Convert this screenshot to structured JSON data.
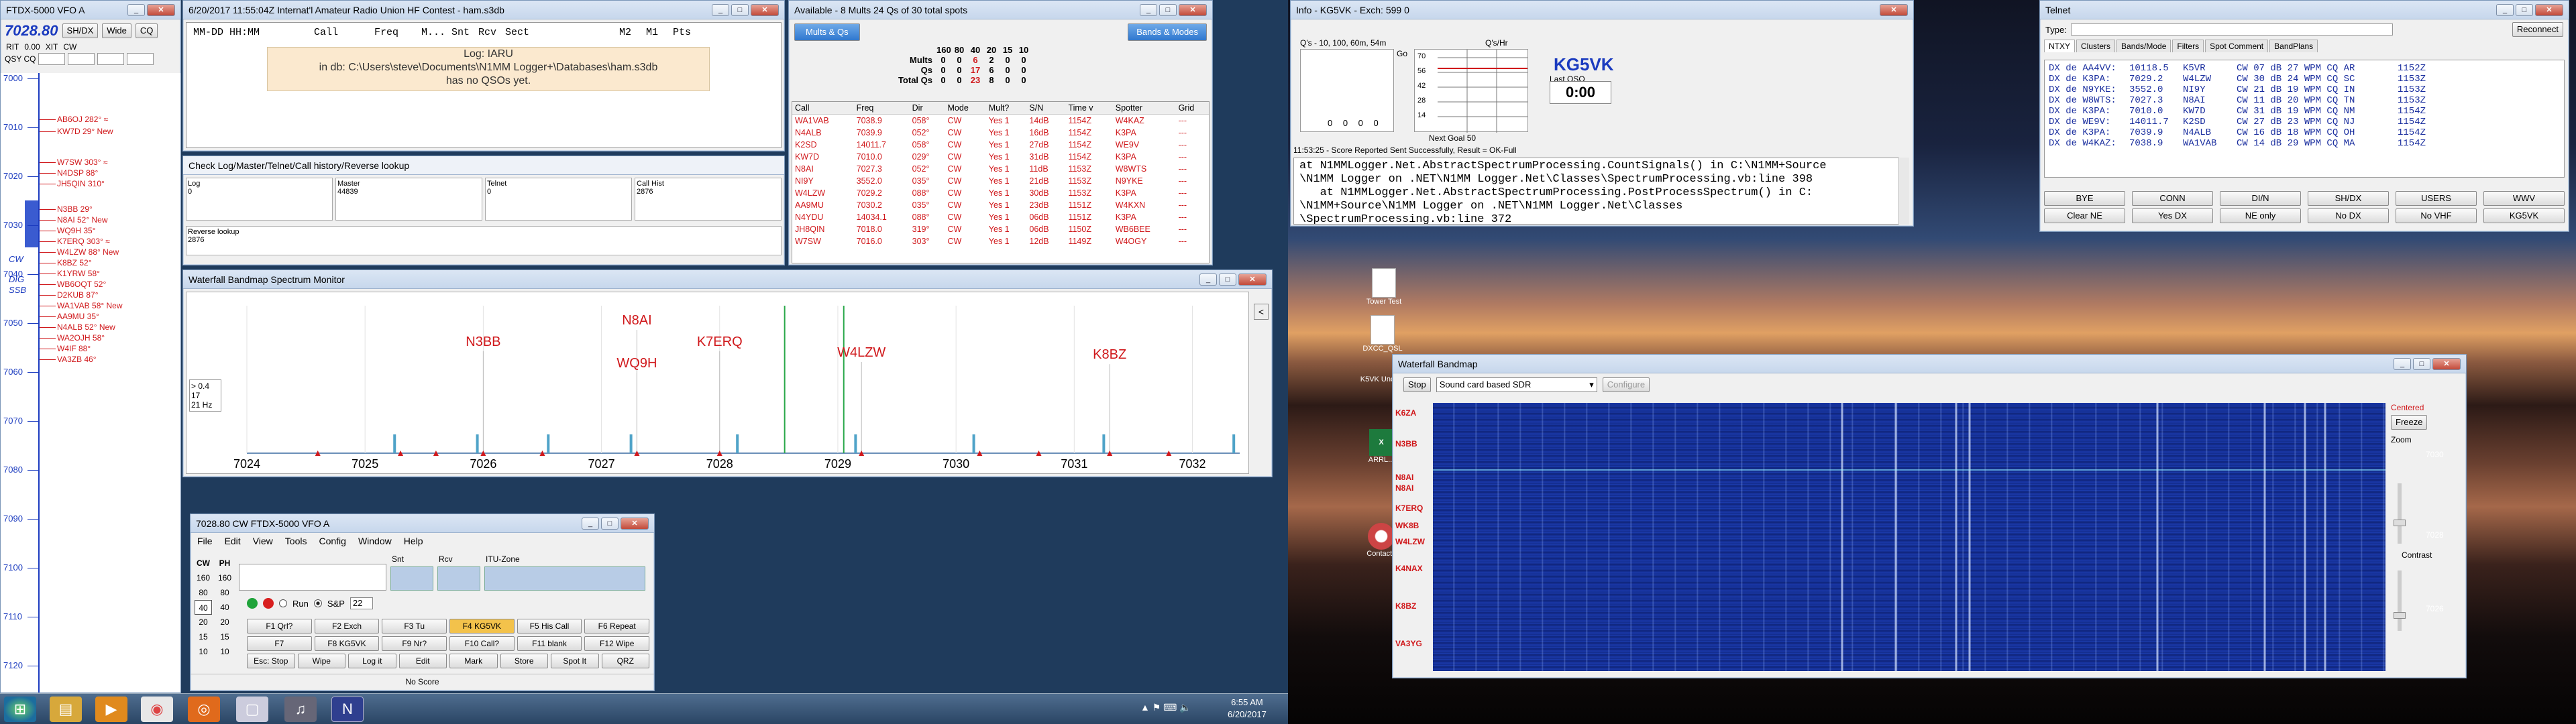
{
  "vfo": {
    "title": "FTDX-5000 VFO A",
    "freq": "7028.80",
    "buttons": [
      "SH/DX",
      "Wide",
      "CQ"
    ],
    "rit": "RIT",
    "rit_val": "0.00",
    "xit": "XIT",
    "cw": "CW",
    "qsy_cq": "QSY CQ",
    "scale": [
      "7000",
      "7010",
      "7020",
      "7030",
      "7040",
      "7050",
      "7060",
      "7070",
      "7080",
      "7090",
      "7100",
      "7110",
      "7120"
    ],
    "mode_labels": [
      "CW",
      "SSB",
      "DIG"
    ],
    "spots": [
      {
        "text": "AB6OJ 282° ≈",
        "color": "#d0181b"
      },
      {
        "text": "KW7D 29° New",
        "color": "#d0181b"
      },
      {
        "text": "W7SW 303° ≈",
        "color": "#d0181b"
      },
      {
        "text": "N4DSP 88°",
        "color": "#d0181b"
      },
      {
        "text": "JH5QIN 310°",
        "color": "#d0181b"
      },
      {
        "text": "N3BB 29°",
        "color": "#d0181b"
      },
      {
        "text": "N8AI 52° New",
        "color": "#d0181b"
      },
      {
        "text": "WQ9H 35°",
        "color": "#d0181b"
      },
      {
        "text": "K7ERQ 303° ≈",
        "color": "#d0181b"
      },
      {
        "text": "W4LZW 88° New",
        "color": "#d0181b"
      },
      {
        "text": "K8BZ 52°",
        "color": "#d0181b"
      },
      {
        "text": "K1YRW 58°",
        "color": "#d0181b"
      },
      {
        "text": "WB6OQT 52°",
        "color": "#d0181b"
      },
      {
        "text": "D2KUB 87°",
        "color": "#d0181b"
      },
      {
        "text": "WA1VAB 58° New",
        "color": "#d0181b"
      },
      {
        "text": "AA9MU 35°",
        "color": "#d0181b"
      },
      {
        "text": "N4ALB 52° New",
        "color": "#d0181b"
      },
      {
        "text": "WA2OJH 58°",
        "color": "#d0181b"
      },
      {
        "text": "W4IF 88°",
        "color": "#d0181b"
      },
      {
        "text": "VA3ZB 46°",
        "color": "#d0181b"
      }
    ]
  },
  "log": {
    "title": "6/20/2017 11:55:04Z  Internat'l Amateur Radio Union HF Contest - ham.s3db",
    "headers": [
      "MM-DD HH:MM",
      "Call",
      "Freq",
      "M...",
      "Snt",
      "Rcv",
      "Sect",
      "M2",
      "M1",
      "Pts"
    ],
    "msg1": "Log: IARU",
    "msg2": "in db: C:\\Users\\steve\\Documents\\N1MM Logger+\\Databases\\ham.s3db",
    "msg3": "has no QSOs yet."
  },
  "checklog": {
    "title": "Check Log/Master/Telnet/Call history/Reverse lookup",
    "cols": [
      {
        "label": "Log",
        "val": "0"
      },
      {
        "label": "Master",
        "val": "44839"
      },
      {
        "label": "Telnet",
        "val": "0"
      },
      {
        "label": "Call Hist",
        "val": "2876"
      }
    ],
    "rev_label": "Reverse lookup",
    "rev_val": "2876"
  },
  "available": {
    "title": "Available - 8 Mults 24 Qs of 30 total spots",
    "btn_left": "Mults & Qs",
    "btn_right": "Bands & Modes",
    "bands": [
      "160",
      "80",
      "40",
      "20",
      "15",
      "10"
    ],
    "rows": [
      {
        "label": "Mults",
        "vals": [
          "0",
          "0",
          "6",
          "2",
          "0",
          "0"
        ]
      },
      {
        "label": "Qs",
        "vals": [
          "0",
          "0",
          "17",
          "6",
          "0",
          "0"
        ]
      },
      {
        "label": "Total Qs",
        "vals": [
          "0",
          "0",
          "23",
          "8",
          "0",
          "0"
        ]
      }
    ],
    "table_headers": [
      "Call",
      "Freq",
      "Dir",
      "Mode",
      "Mult?",
      "S/N",
      "Time v",
      "Spotter",
      "Grid"
    ],
    "table_rows": [
      [
        "WA1VAB",
        "7038.9",
        "058°",
        "CW",
        "Yes 1",
        "14dB",
        "1154Z",
        "W4KAZ",
        "---"
      ],
      [
        "N4ALB",
        "7039.9",
        "052°",
        "CW",
        "Yes 1",
        "16dB",
        "1154Z",
        "K3PA",
        "---"
      ],
      [
        "K2SD",
        "14011.7",
        "058°",
        "CW",
        "Yes 1",
        "27dB",
        "1154Z",
        "WE9V",
        "---"
      ],
      [
        "KW7D",
        "7010.0",
        "029°",
        "CW",
        "Yes 1",
        "31dB",
        "1154Z",
        "K3PA",
        "---"
      ],
      [
        "N8AI",
        "7027.3",
        "052°",
        "CW",
        "Yes 1",
        "11dB",
        "1153Z",
        "W8WTS",
        "---"
      ],
      [
        "NI9Y",
        "3552.0",
        "035°",
        "CW",
        "Yes 1",
        "21dB",
        "1153Z",
        "N9YKE",
        "---"
      ],
      [
        "W4LZW",
        "7029.2",
        "088°",
        "CW",
        "Yes 1",
        "30dB",
        "1153Z",
        "K3PA",
        "---"
      ],
      [
        "AA9MU",
        "7030.2",
        "035°",
        "CW",
        "Yes 1",
        "23dB",
        "1151Z",
        "W4KXN",
        "---"
      ],
      [
        "N4YDU",
        "14034.1",
        "088°",
        "CW",
        "Yes 1",
        "06dB",
        "1151Z",
        "K3PA",
        "---"
      ],
      [
        "JH8QIN",
        "7018.0",
        "319°",
        "CW",
        "Yes 1",
        "06dB",
        "1150Z",
        "WB6BEE",
        "---"
      ],
      [
        "W7SW",
        "7016.0",
        "303°",
        "CW",
        "Yes 1",
        "12dB",
        "1149Z",
        "W4OGY",
        "---"
      ]
    ]
  },
  "bandmap": {
    "title": "Waterfall Bandmap Spectrum Monitor",
    "side": [
      "> 0.4",
      "17",
      "21 Hz"
    ],
    "axis": [
      "7024",
      "7025",
      "7026",
      "7027",
      "7028",
      "7029",
      "7030",
      "7031",
      "7032"
    ],
    "spot_labels": [
      {
        "call": "N3BB",
        "freq": 7026.0,
        "row": 0
      },
      {
        "call": "N8AI",
        "freq": 7027.3,
        "row": -1
      },
      {
        "call": "WQ9H",
        "freq": 7027.3,
        "row": 1
      },
      {
        "call": "K7ERQ",
        "freq": 7028.0,
        "row": 0
      },
      {
        "call": "W4LZW",
        "freq": 7029.2,
        "row": 0.5
      },
      {
        "call": "K8BZ",
        "freq": 7031.3,
        "row": 0.6
      }
    ]
  },
  "entry": {
    "title": "7028.80 CW FTDX-5000 VFO A",
    "menu": [
      "File",
      "Edit",
      "View",
      "Tools",
      "Config",
      "Window",
      "Help"
    ],
    "bands_cw": [
      "CW",
      "160",
      "80",
      "40",
      "20",
      "15",
      "10"
    ],
    "bands_ph": [
      "PH",
      "160",
      "80",
      "40",
      "20",
      "15",
      "10"
    ],
    "field_labels": [
      "Snt",
      "Rcv",
      "ITU-Zone"
    ],
    "run": "Run",
    "sp": "S&P",
    "sp_num": "22",
    "fkeys": [
      [
        "F1 Qrl?",
        "F2 Exch",
        "F3 Tu",
        "F4 KG5VK",
        "F5 His Call",
        "F6 Repeat"
      ],
      [
        "F7",
        "F8 KG5VK",
        "F9 Nr?",
        "F10 Call?",
        "F11 blank",
        "F12 Wipe"
      ],
      [
        "Esc: Stop",
        "Wipe",
        "Log it",
        "Edit",
        "Mark",
        "Store",
        "Spot It",
        "QRZ"
      ]
    ],
    "status": "No Score"
  },
  "info": {
    "title": "Info - KG5VK - Exch: 599 0",
    "qs_label": "Q's - 10, 100, 60m, 54m",
    "go": "Go",
    "zeros": "0 0 0 0",
    "rate_title": "Q's/Hr",
    "rate_ticks": [
      "70",
      "56",
      "42",
      "28",
      "14"
    ],
    "next_goal": "Next Goal 50",
    "call": "KG5VK",
    "last_qso": "Last QSO",
    "time": "0:00",
    "score_line": "11:53:25 - Score Reported Sent Successfully, Result = OK-Full",
    "stack": [
      "at N1MMLogger.Net.AbstractSpectrumProcessing.CountSignals() in C:\\N1MM+Source",
      "\\N1MM Logger on .NET\\N1MM Logger.Net\\Classes\\SpectrumProcessing.vb:line 398",
      "   at N1MMLogger.Net.AbstractSpectrumProcessing.PostProcessSpectrum() in C:",
      "\\N1MM+Source\\N1MM Logger on .NET\\N1MM Logger.Net\\Classes",
      "\\SpectrumProcessing.vb:line 372"
    ]
  },
  "telnet": {
    "title": "Telnet",
    "type_label": "Type:",
    "reconnect": "Reconnect",
    "tabs": [
      "NTXY",
      "Clusters",
      "Bands/Mode",
      "Filters",
      "Spot Comment",
      "BandPlans"
    ],
    "lines": [
      [
        "DX de AA4VV:",
        "10118.5",
        "K5VR",
        "CW 07 dB 27 WPM CQ AR",
        "1152Z"
      ],
      [
        "DX de K3PA:",
        "7029.2",
        "W4LZW",
        "CW 30 dB 24 WPM CQ SC",
        "1153Z"
      ],
      [
        "DX de N9YKE:",
        "3552.0",
        "NI9Y",
        "CW 21 dB 19 WPM CQ IN",
        "1153Z"
      ],
      [
        "DX de W8WTS:",
        "7027.3",
        "N8AI",
        "CW 11 dB 20 WPM CQ TN",
        "1153Z"
      ],
      [
        "DX de K3PA:",
        "7010.0",
        "KW7D",
        "CW 31 dB 19 WPM CQ NM",
        "1154Z"
      ],
      [
        "DX de WE9V:",
        "14011.7",
        "K2SD",
        "CW 27 dB 23 WPM CQ NJ",
        "1154Z"
      ],
      [
        "DX de K3PA:",
        "7039.9",
        "N4ALB",
        "CW 16 dB 18 WPM CQ OH",
        "1154Z"
      ],
      [
        "DX de W4KAZ:",
        "7038.9",
        "WA1VAB",
        "CW 14 dB 29 WPM CQ MA",
        "1154Z"
      ]
    ],
    "btn_row1": [
      "BYE",
      "CONN",
      "DI/N",
      "SH/DX",
      "USERS",
      "WWV"
    ],
    "btn_row2": [
      "Clear NE",
      "Yes DX",
      "NE only",
      "No DX",
      "No VHF",
      "KG5VK"
    ]
  },
  "waterfall": {
    "title": "Waterfall Bandmap",
    "stop": "Stop",
    "source": "Sound card based SDR",
    "configure": "Configure",
    "calls": [
      "K6ZA",
      "N3BB",
      "N8AI",
      "N8AI",
      "K7ERQ",
      "WK8B",
      "W4LZW",
      "K4NAX",
      "K8BZ",
      "VA3YG"
    ],
    "centered": "Centered",
    "freeze": "Freeze",
    "zoom": "Zoom",
    "contrast": "Contrast",
    "scale": [
      "7030",
      "7028",
      "7026"
    ]
  },
  "desktop_icons": [
    "Tower Test",
    "DXCC_QSL",
    "K5VK Uncle...",
    "Contacts",
    "ARRL..."
  ],
  "taskbar": {
    "time": "6:55 AM",
    "date": "6/20/2017"
  }
}
